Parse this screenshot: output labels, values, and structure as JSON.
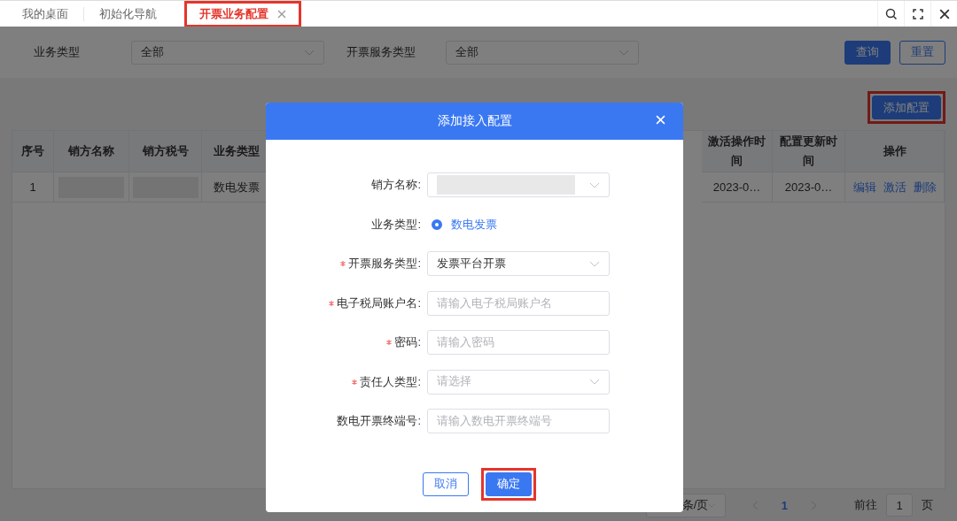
{
  "tabs": [
    {
      "label": "我的桌面",
      "selected": false,
      "closable": false,
      "highlighted": false
    },
    {
      "label": "初始化导航",
      "selected": false,
      "closable": false,
      "highlighted": false
    },
    {
      "label": "开票业务配置",
      "selected": true,
      "closable": true,
      "highlighted": true
    }
  ],
  "filters": [
    {
      "label": "业务类型",
      "value": "全部"
    },
    {
      "label": "开票服务类型",
      "value": "全部"
    }
  ],
  "filter_buttons": [
    {
      "label": "查询",
      "kind": "primary"
    },
    {
      "label": "重置",
      "kind": "outline"
    }
  ],
  "add_button": {
    "label": "添加配置",
    "highlighted": true
  },
  "table": {
    "columns": [
      "序号",
      "销方名称",
      "销方税号",
      "业务类型",
      "激活操作时间",
      "配置更新时间",
      "操作"
    ],
    "rows": [
      {
        "cells": [
          {
            "kind": "text",
            "text": "1"
          },
          {
            "kind": "redacted"
          },
          {
            "kind": "redacted"
          },
          {
            "kind": "text",
            "text": "数电发票"
          },
          {
            "kind": "text",
            "text": "2023-0…"
          },
          {
            "kind": "text",
            "text": "2023-0…"
          }
        ],
        "actions": [
          "编辑",
          "激活",
          "删除"
        ]
      }
    ]
  },
  "pagination": {
    "page_size": "条/页",
    "pages": [
      {
        "label": "1",
        "selected": true
      }
    ],
    "goto_label": "前往",
    "goto_value": "1",
    "page_unit": "页"
  },
  "dialog": {
    "title": "添加接入配置",
    "fields": [
      {
        "kind": "select",
        "label": "销方名称:",
        "required": false,
        "redacted": true
      },
      {
        "kind": "radio",
        "label": "业务类型:",
        "required": false,
        "options": [
          {
            "label": "数电发票",
            "selected": true
          }
        ]
      },
      {
        "kind": "select",
        "label": "开票服务类型:",
        "required": true,
        "value": "发票平台开票"
      },
      {
        "kind": "input",
        "label": "电子税局账户名:",
        "required": true,
        "placeholder": "请输入电子税局账户名"
      },
      {
        "kind": "input",
        "label": "密码:",
        "required": true,
        "placeholder": "请输入密码"
      },
      {
        "kind": "select",
        "label": "责任人类型:",
        "required": true,
        "placeholder": "请选择"
      },
      {
        "kind": "input",
        "label": "数电开票终端号:",
        "required": false,
        "placeholder": "请输入数电开票终端号"
      }
    ],
    "buttons": [
      {
        "label": "取消",
        "kind": "outline",
        "highlighted": false
      },
      {
        "label": "确定",
        "kind": "primary",
        "highlighted": true
      }
    ]
  }
}
